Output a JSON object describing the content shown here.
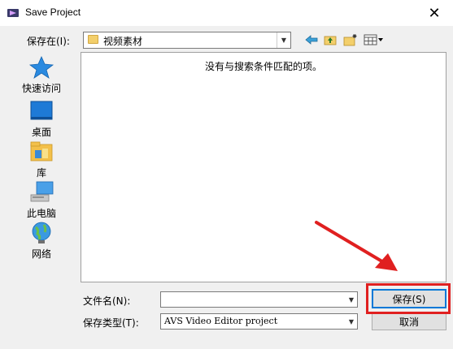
{
  "window": {
    "title": "Save Project",
    "close_glyph": "✕"
  },
  "save_in": {
    "label": "保存在(I):",
    "value": "视频素材"
  },
  "sidebar": {
    "items": [
      {
        "label": "快速访问",
        "icon": "quick-access-star-icon"
      },
      {
        "label": "桌面",
        "icon": "desktop-icon"
      },
      {
        "label": "库",
        "icon": "library-icon"
      },
      {
        "label": "此电脑",
        "icon": "this-pc-icon"
      },
      {
        "label": "网络",
        "icon": "network-icon"
      }
    ]
  },
  "content": {
    "empty_message": "没有与搜索条件匹配的项。"
  },
  "filename": {
    "label": "文件名(N):",
    "value": ""
  },
  "filetype": {
    "label": "保存类型(T):",
    "value": "AVS Video Editor project"
  },
  "buttons": {
    "save": "保存(S)",
    "cancel": "取消"
  },
  "colors": {
    "annotation": "#e02020",
    "accent": "#0078d7"
  }
}
